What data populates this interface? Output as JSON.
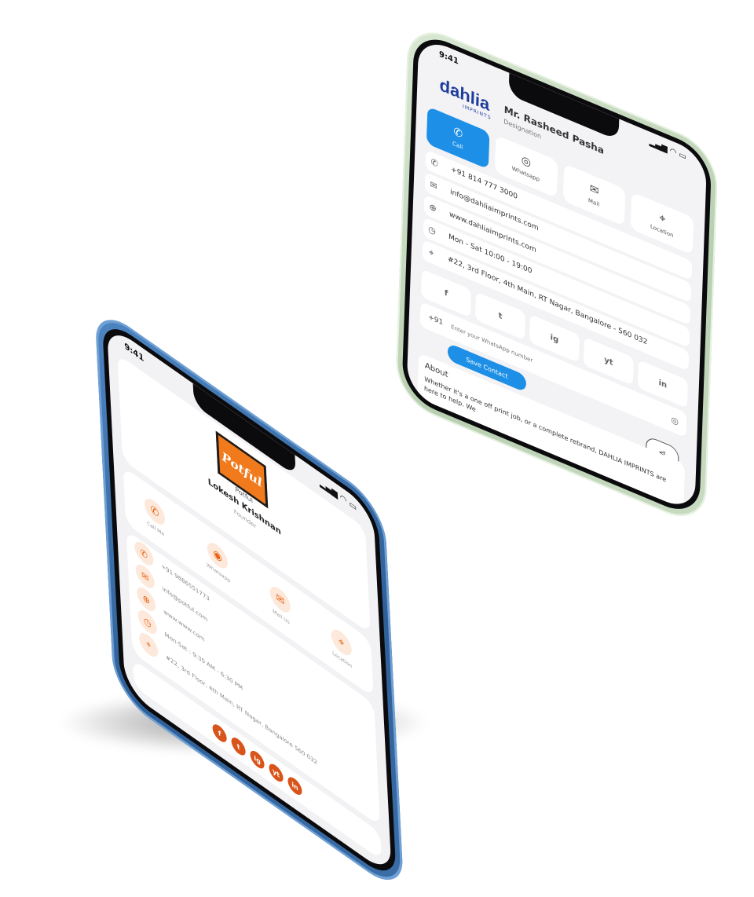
{
  "left_phone": {
    "status_time": "9:41",
    "logo_text": "Potful",
    "company": "Potful",
    "name": "Lokesh Krishnan",
    "role": "Founder",
    "actions": [
      {
        "icon": "phone-icon",
        "label": "Call Me"
      },
      {
        "icon": "whatsapp-icon",
        "label": "Whatsapp"
      },
      {
        "icon": "mail-icon",
        "label": "Mail Us"
      },
      {
        "icon": "location-icon",
        "label": "Location"
      }
    ],
    "details": [
      {
        "icon": "phone-icon",
        "text": "+91 9886551773"
      },
      {
        "icon": "mail-icon",
        "text": "info@potful.com"
      },
      {
        "icon": "globe-icon",
        "text": "www.www.com"
      },
      {
        "icon": "clock-icon",
        "text": "Mon-Sat : 9:30 AM - 6:30 PM"
      },
      {
        "icon": "location-icon",
        "text": "#22, 3rd Floor, 4th Main, RT Nagar, Bangalore 560 032"
      }
    ],
    "social": [
      "f",
      "t",
      "ig",
      "yt",
      "in"
    ],
    "accent": "#e8620e"
  },
  "right_phone": {
    "status_time": "9:41",
    "logo_text": "dahlia",
    "logo_sub": "IMPRINTS",
    "name": "Mr. Rasheed Pasha",
    "role": "Designation",
    "actions": [
      {
        "icon": "phone-icon",
        "label": "Call",
        "active": true
      },
      {
        "icon": "whatsapp-icon",
        "label": "Whatsapp"
      },
      {
        "icon": "mail-icon",
        "label": "Mail"
      },
      {
        "icon": "location-icon",
        "label": "Location"
      }
    ],
    "details": [
      {
        "icon": "phone-icon",
        "text": "+91 814 777 3000"
      },
      {
        "icon": "mail-icon",
        "text": "info@dahliaimprints.com"
      },
      {
        "icon": "globe-icon",
        "text": "www.dahliaimprints.com"
      },
      {
        "icon": "clock-icon",
        "text": "Mon - Sat 10:00 - 19:00"
      },
      {
        "icon": "location-icon",
        "text": "#22, 3rd Floor, 4th Main, RT Nagar, Bangalore - 560 032"
      }
    ],
    "social": [
      "f",
      "t",
      "ig",
      "yt",
      "in"
    ],
    "phone_prefix": "+91",
    "phone_placeholder": "Enter your WhatsApp number",
    "save_label": "Save Contact",
    "about_heading": "About",
    "about_text": "Whether it's a one off print job, or a complete rebrand, DAHLIA IMPRINTS are here to help. We",
    "accent": "#1d8fe6"
  }
}
